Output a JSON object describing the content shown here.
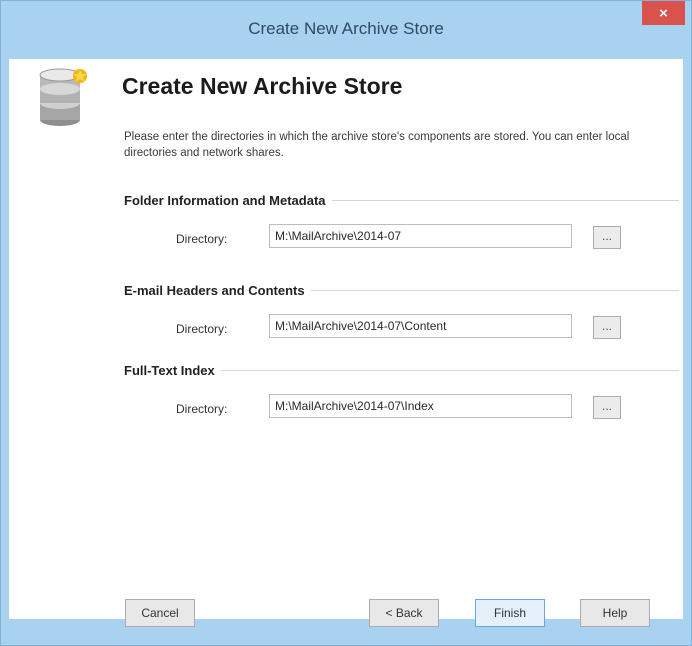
{
  "window": {
    "title": "Create New Archive Store",
    "close_glyph": "×"
  },
  "page": {
    "heading": "Create New Archive Store",
    "description": "Please enter the directories in which the archive store's components are stored. You can enter local directories and network shares."
  },
  "sections": [
    {
      "title": "Folder Information and Metadata",
      "directory_label": "Directory:",
      "directory_value": "M:\\MailArchive\\2014-07",
      "browse_label": "..."
    },
    {
      "title": "E-mail Headers and Contents",
      "directory_label": "Directory:",
      "directory_value": "M:\\MailArchive\\2014-07\\Content",
      "browse_label": "..."
    },
    {
      "title": "Full-Text Index",
      "directory_label": "Directory:",
      "directory_value": "M:\\MailArchive\\2014-07\\Index",
      "browse_label": "..."
    }
  ],
  "buttons": {
    "cancel": "Cancel",
    "back": "< Back",
    "finish": "Finish",
    "help": "Help"
  },
  "icons": {
    "header_icon": "database-star-icon"
  },
  "colors": {
    "titlebar": "#a9d2f1",
    "close": "#d9534c",
    "accent": "#6aa6dd"
  }
}
